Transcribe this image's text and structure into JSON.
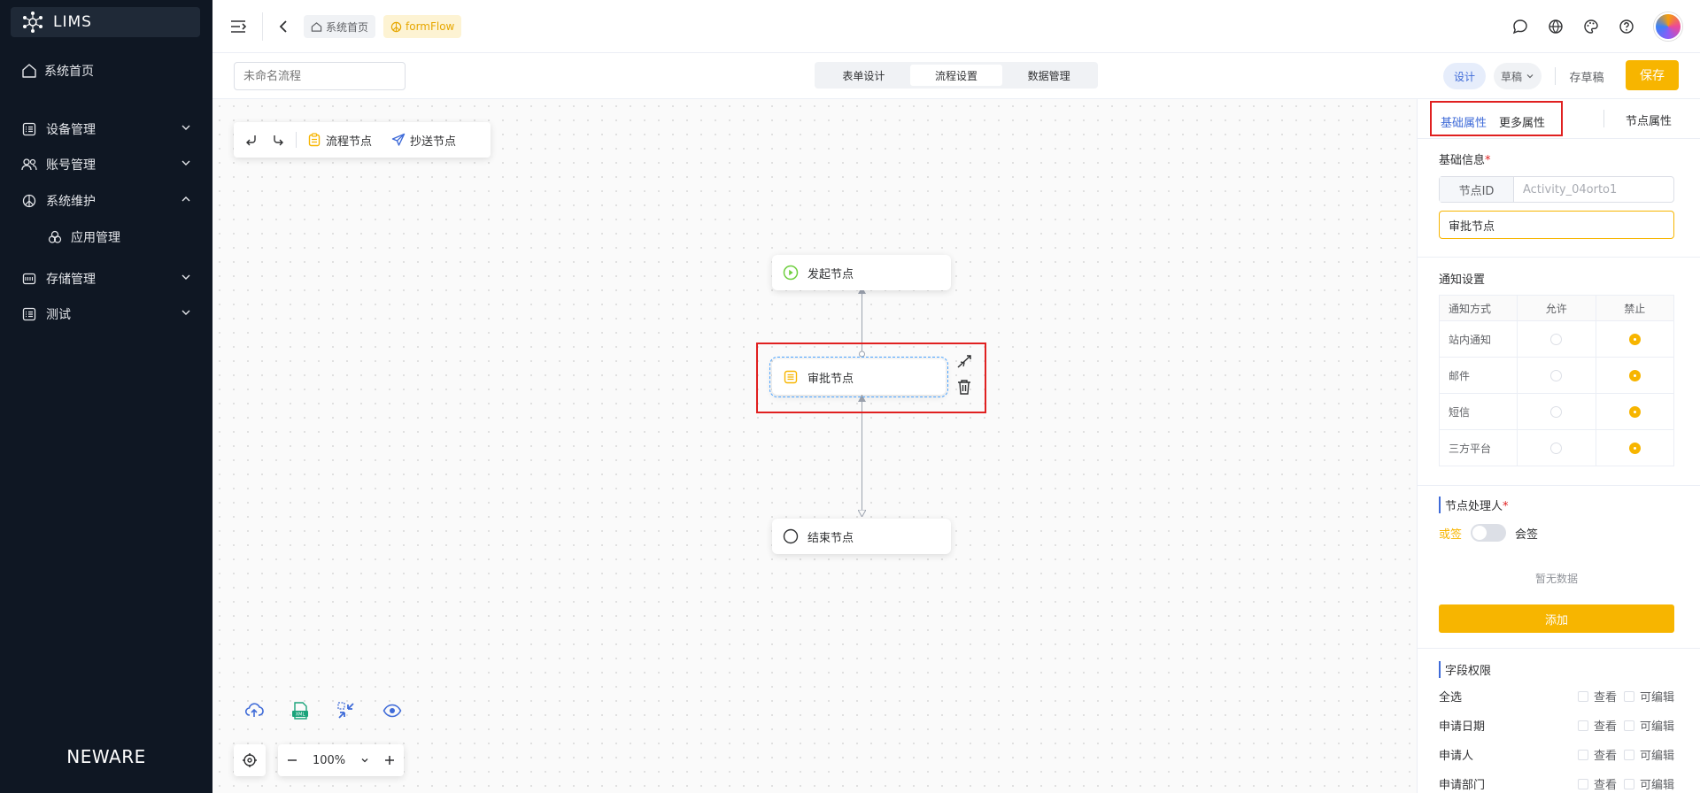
{
  "sidebar": {
    "app_name": "LIMS",
    "home": "系统首页",
    "items": [
      {
        "label": "设备管理",
        "icon": "list-icon",
        "expanded": false
      },
      {
        "label": "账号管理",
        "icon": "users-icon",
        "expanded": false
      },
      {
        "label": "系统维护",
        "icon": "peace-icon",
        "expanded": true
      },
      {
        "label": "存储管理",
        "icon": "storage-icon",
        "expanded": false
      },
      {
        "label": "测试",
        "icon": "list-icon",
        "expanded": false
      }
    ],
    "sub_item": "应用管理",
    "brand": "NEWARE"
  },
  "header": {
    "breadcrumb_home": "系统首页",
    "breadcrumb_current": "formFlow"
  },
  "toolbar": {
    "flow_name_placeholder": "未命名流程",
    "tabs": [
      "表单设计",
      "流程设置",
      "数据管理"
    ],
    "active_tab": "流程设置",
    "design_tag": "设计",
    "draft_select": "草稿",
    "save_draft": "存草稿",
    "save": "保存"
  },
  "canvas": {
    "palette": {
      "flow_node": "流程节点",
      "cc_node": "抄送节点"
    },
    "nodes": {
      "start": "发起节点",
      "approve": "审批节点",
      "end": "结束节点"
    },
    "zoom": "100%"
  },
  "panel": {
    "tabs": {
      "basic": "基础属性",
      "more": "更多属性",
      "node": "节点属性"
    },
    "basic_info": {
      "title": "基础信息",
      "required_mark": "*",
      "id_label": "节点ID",
      "id_placeholder": "Activity_04orto1",
      "name_value": "审批节点"
    },
    "notify": {
      "title": "通知设置",
      "headers": [
        "通知方式",
        "允许",
        "禁止"
      ],
      "rows": [
        {
          "label": "站内通知",
          "allowed": false
        },
        {
          "label": "邮件",
          "allowed": false
        },
        {
          "label": "短信",
          "allowed": false
        },
        {
          "label": "三方平台",
          "allowed": false
        }
      ]
    },
    "handler": {
      "title": "节点处理人",
      "required_mark": "*",
      "or_sign": "或签",
      "co_sign": "会签",
      "empty": "暂无数据",
      "add": "添加"
    },
    "fields": {
      "title": "字段权限",
      "view": "查看",
      "edit": "可编辑",
      "rows": [
        "全选",
        "申请日期",
        "申请人",
        "申请部门"
      ]
    }
  },
  "colors": {
    "sidebar_bg": "#0f1723",
    "accent": "#f7b500",
    "primary": "#3f6bd8",
    "highlight": "#e02020"
  }
}
